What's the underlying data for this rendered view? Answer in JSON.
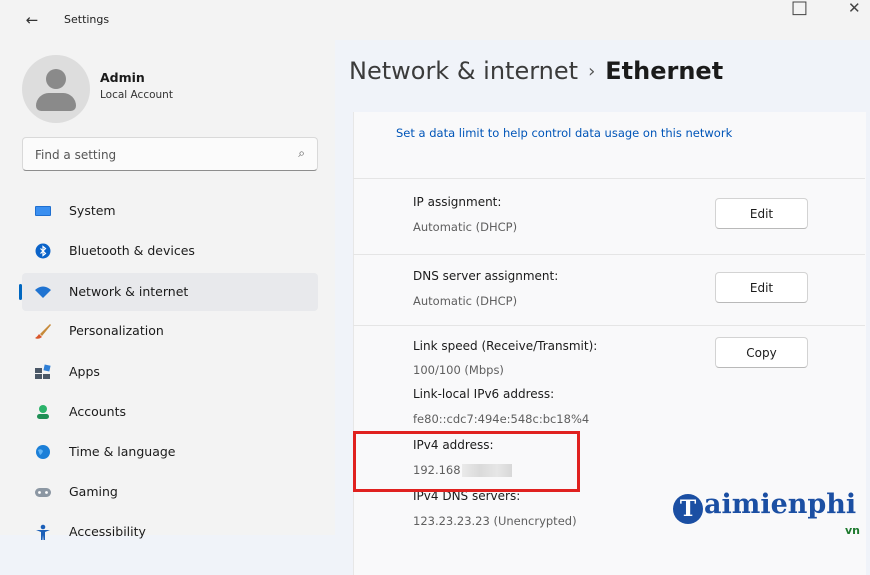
{
  "window": {
    "back": "←",
    "title": "Settings",
    "minimize": "□",
    "close": "✕"
  },
  "user": {
    "name": "Admin",
    "type": "Local Account"
  },
  "search": {
    "placeholder": "Find a setting",
    "icon": "⌕"
  },
  "nav": [
    {
      "label": "System",
      "icon": "system-icon",
      "selected": false
    },
    {
      "label": "Bluetooth & devices",
      "icon": "bluetooth-icon",
      "selected": false
    },
    {
      "label": "Network & internet",
      "icon": "wifi-icon",
      "selected": true
    },
    {
      "label": "Personalization",
      "icon": "brush-icon",
      "selected": false
    },
    {
      "label": "Apps",
      "icon": "apps-icon",
      "selected": false
    },
    {
      "label": "Accounts",
      "icon": "person-icon",
      "selected": false
    },
    {
      "label": "Time & language",
      "icon": "globe-icon",
      "selected": false
    },
    {
      "label": "Gaming",
      "icon": "gamepad-icon",
      "selected": false
    },
    {
      "label": "Accessibility",
      "icon": "accessibility-icon",
      "selected": false
    }
  ],
  "header": {
    "parent": "Network & internet",
    "separator": "›",
    "current": "Ethernet"
  },
  "data_limit_link": "Set a data limit to help control data usage on this network",
  "ip_assignment": {
    "label": "IP assignment:",
    "value": "Automatic (DHCP)",
    "button": "Edit"
  },
  "dns_assignment": {
    "label": "DNS server assignment:",
    "value": "Automatic (DHCP)",
    "button": "Edit"
  },
  "properties": {
    "copy_button": "Copy",
    "link_speed_label": "Link speed (Receive/Transmit):",
    "link_speed_value": "100/100 (Mbps)",
    "ipv6_label": "Link-local IPv6 address:",
    "ipv6_value": "fe80::cdc7:494e:548c:bc18%4",
    "ipv4_label": "IPv4 address:",
    "ipv4_value": "192.168",
    "dns_servers_label": "IPv4 DNS servers:",
    "dns_servers_value": "123.23.23.23 (Unencrypted)"
  },
  "colors": {
    "accent": "#0067c0",
    "highlight_box": "#e0211f",
    "link": "#0055b8"
  },
  "watermark": {
    "logo_letter": "T",
    "text": "aimienphi",
    "suffix": "vn"
  }
}
